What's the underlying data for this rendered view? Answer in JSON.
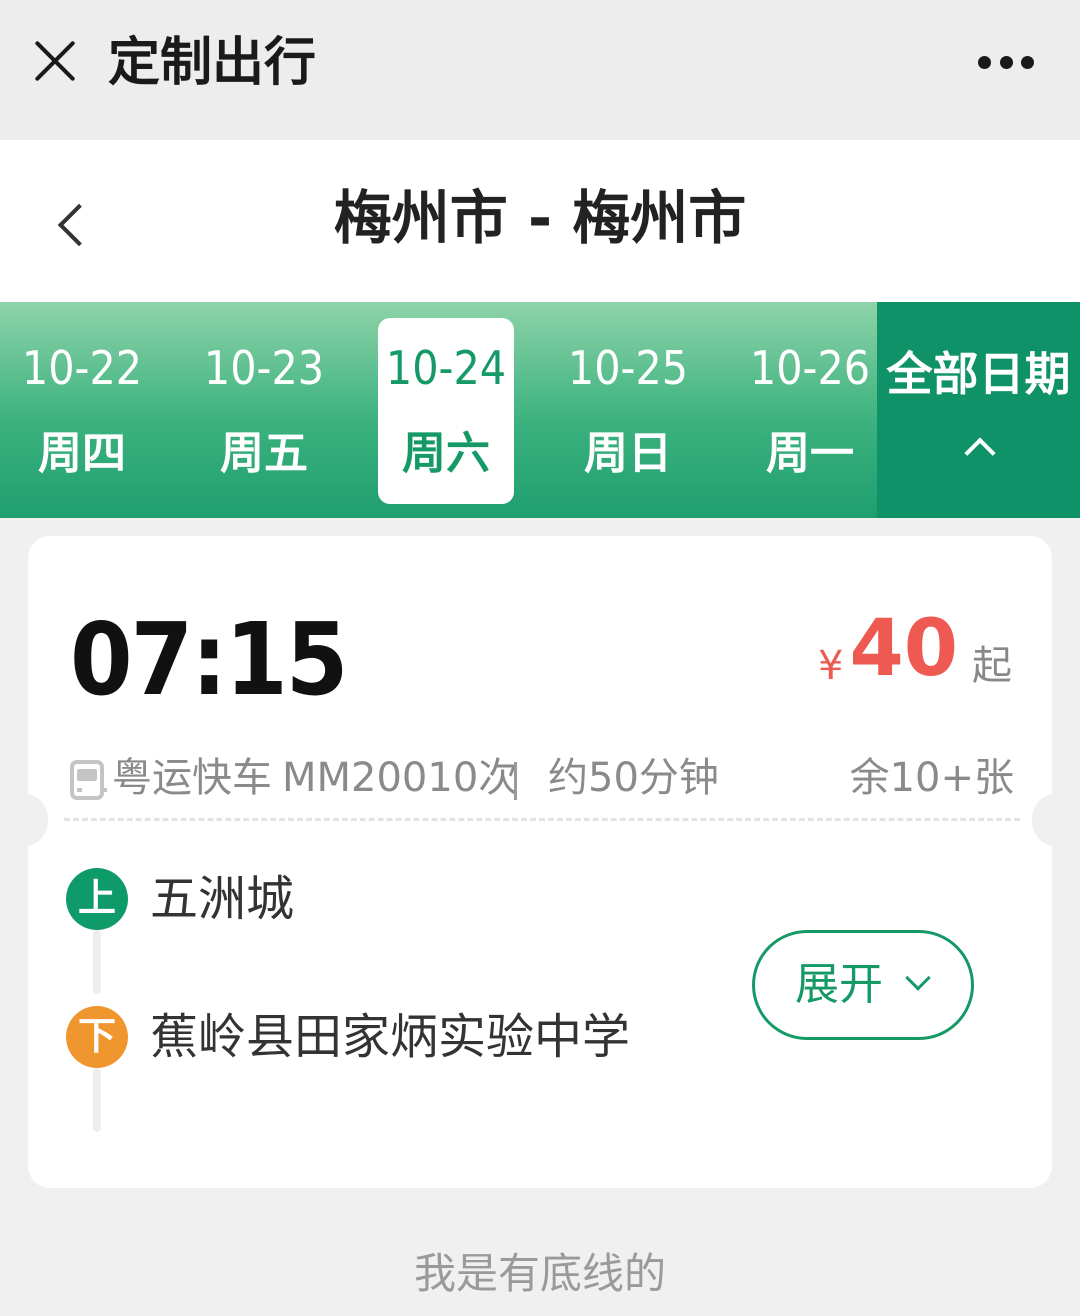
{
  "topbar": {
    "title": "定制出行",
    "close_icon": "close-icon",
    "more_icon": "more-icon"
  },
  "header": {
    "route": "梅州市 - 梅州市",
    "back_icon": "chevron-left-icon"
  },
  "dates": [
    {
      "date": "10-22",
      "weekday": "周四",
      "selected": false
    },
    {
      "date": "10-23",
      "weekday": "周五",
      "selected": false
    },
    {
      "date": "10-24",
      "weekday": "周六",
      "selected": true
    },
    {
      "date": "10-25",
      "weekday": "周日",
      "selected": false
    },
    {
      "date": "10-26",
      "weekday": "周一",
      "selected": false
    }
  ],
  "all_dates": {
    "label": "全部日期",
    "icon": "chevron-up-icon"
  },
  "ticket": {
    "time": "07:15",
    "currency": "¥",
    "price": "40",
    "price_suffix": "起",
    "bus_icon": "bus-icon",
    "bus_name": "粤运快车",
    "train_no": "MM20010次",
    "duration": "约50分钟",
    "remaining": "余10+张",
    "board": {
      "badge": "上",
      "name": "五洲城"
    },
    "alight": {
      "badge": "下",
      "name": "蕉岭县田家炳实验中学"
    },
    "expand_label": "展开"
  },
  "footer": {
    "text": "我是有底线的"
  },
  "colors": {
    "accent": "#159a67",
    "price": "#ee5a52",
    "alight": "#f0962e"
  }
}
